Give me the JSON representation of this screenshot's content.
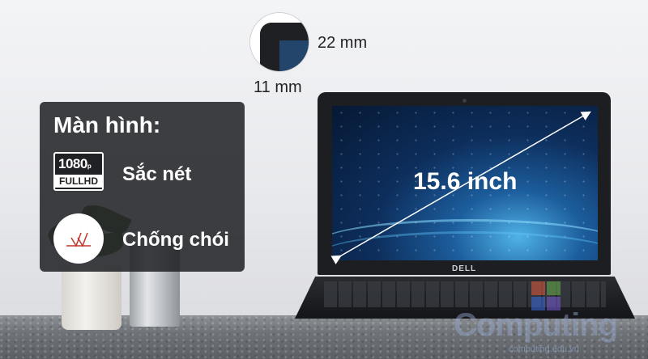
{
  "panel": {
    "title": "Màn hình:",
    "features": [
      {
        "icon": "fullhd-1080p-icon",
        "label": "Sắc nét"
      },
      {
        "icon": "anti-glare-icon",
        "label": "Chống chói"
      }
    ],
    "badge": {
      "top": "1080",
      "top_suffix": "p",
      "bottom": "FULLHD"
    }
  },
  "bezel": {
    "top_dimension": "22 mm",
    "side_dimension": "11 mm"
  },
  "laptop": {
    "screen_size": "15.6 inch",
    "brand": "DELL"
  },
  "watermark": {
    "text": "Computing",
    "sub": "computing.edu.vn"
  }
}
